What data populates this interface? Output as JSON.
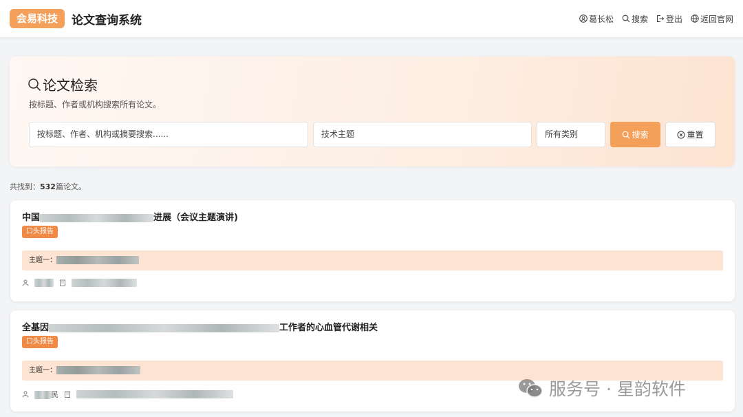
{
  "header": {
    "logo": "会易科技",
    "title": "论文查询系统",
    "nav": [
      {
        "label": "葛长松",
        "icon": "user-icon"
      },
      {
        "label": "搜索",
        "icon": "search-icon"
      },
      {
        "label": "登出",
        "icon": "logout-icon"
      },
      {
        "label": "返回官网",
        "icon": "globe-icon"
      }
    ]
  },
  "search": {
    "title": "论文检索",
    "subtitle": "按标题、作者或机构搜索所有论文。",
    "main_placeholder": "按标题、作者、机构或摘要搜索......",
    "topic_placeholder": "技术主题",
    "category_value": "所有类别",
    "search_button": "搜索",
    "reset_button": "重置"
  },
  "results": {
    "prefix": "共找到：",
    "count": "532",
    "suffix": "篇论文。"
  },
  "papers": [
    {
      "title_start": "中国",
      "title_end": "进展（会议主题演讲)",
      "tag": "口头报告",
      "topic_label": "主题一："
    },
    {
      "title_start": "全基因",
      "title_end": "工作者的心血管代谢相关",
      "tag": "口头报告",
      "topic_label": "主题一：",
      "author_end": "民"
    }
  ],
  "watermark": "服务号 · 星韵软件",
  "colors": {
    "accent": "#f5a05a",
    "tag": "#f08a44",
    "topic_bg": "#fde3d2"
  }
}
